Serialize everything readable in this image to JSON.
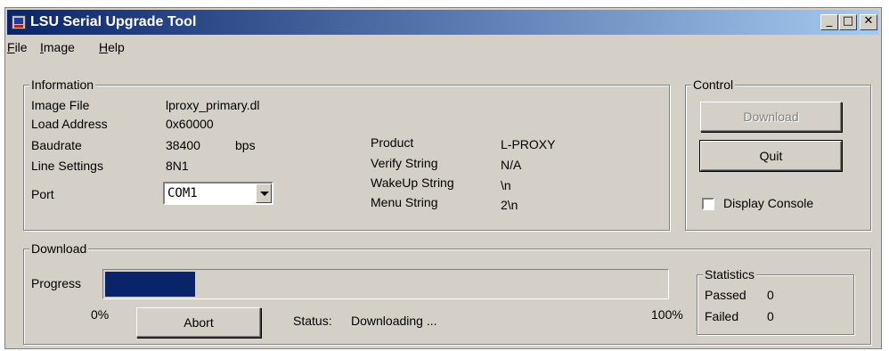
{
  "window": {
    "title": "LSU Serial Upgrade Tool"
  },
  "menu": [
    {
      "key": "F",
      "rest": "ile"
    },
    {
      "key": "I",
      "rest": "mage"
    },
    {
      "key": "H",
      "rest": "elp"
    }
  ],
  "information": {
    "legend": "Information",
    "image_file_label": "Image File",
    "image_file_value": "lproxy_primary.dl",
    "load_address_label": "Load Address",
    "load_address_value": "0x60000",
    "baudrate_label": "Baudrate",
    "baudrate_value": "38400",
    "baudrate_unit": "bps",
    "line_settings_label": "Line Settings",
    "line_settings_value": "8N1",
    "port_label": "Port",
    "port_value": "COM1",
    "product_label": "Product",
    "product_value": "L-PROXY",
    "verify_label": "Verify String",
    "verify_value": "N/A",
    "wakeup_label": "WakeUp String",
    "wakeup_value": "\\n",
    "menu_string_label": "Menu String",
    "menu_string_value": "2\\n"
  },
  "control": {
    "legend": "Control",
    "download_label": "Download",
    "quit_label": "Quit",
    "display_console_label": "Display Console",
    "display_console_checked": false
  },
  "download": {
    "legend": "Download",
    "progress_label": "Progress",
    "progress_fraction": 0.16,
    "min_label": "0%",
    "max_label": "100%",
    "abort_label": "Abort",
    "status_label": "Status:",
    "status_value": "Downloading ..."
  },
  "statistics": {
    "legend": "Statistics",
    "passed_label": "Passed",
    "passed_value": "0",
    "failed_label": "Failed",
    "failed_value": "0"
  },
  "colors": {
    "titlebar_start": "#0a246a",
    "titlebar_end": "#a6caf0",
    "progress_fill": "#0a246a",
    "face": "#d4d0c8"
  }
}
